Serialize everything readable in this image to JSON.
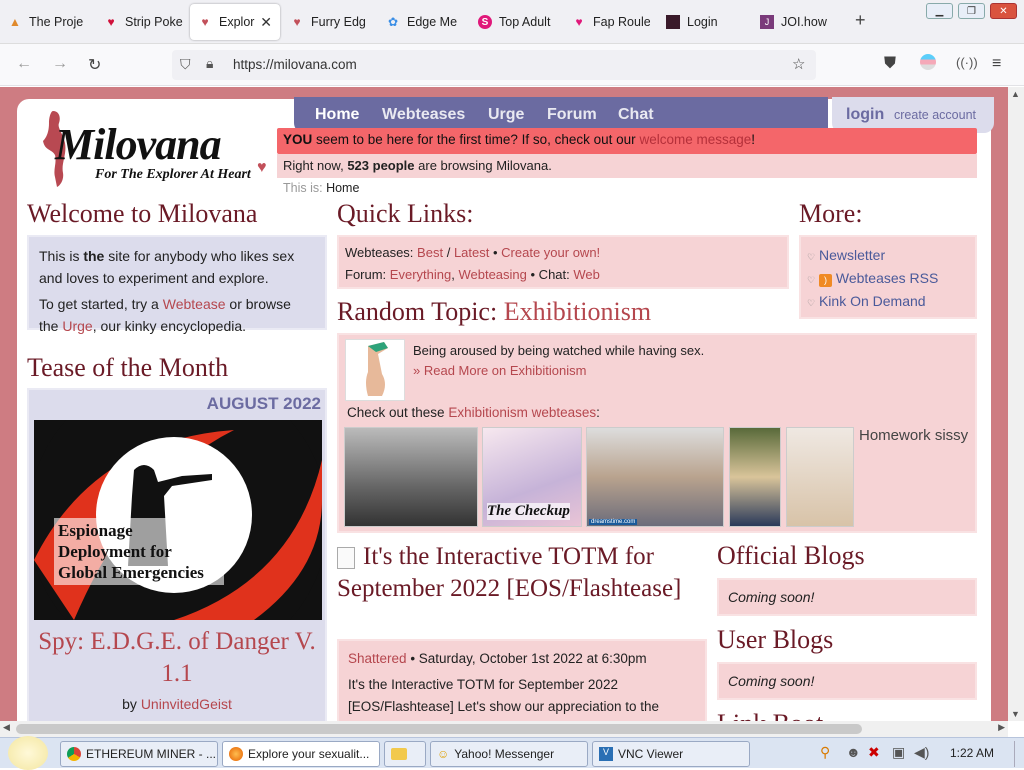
{
  "browser": {
    "tabs": [
      {
        "title": "The Proje",
        "icon": "project-icon"
      },
      {
        "title": "Strip Poke",
        "icon": "heart-icon"
      },
      {
        "title": "Explor",
        "icon": "milovana-heart-icon",
        "active": true
      },
      {
        "title": "Furry Edg",
        "icon": "milovana-heart-icon"
      },
      {
        "title": "Edge Me",
        "icon": "puzzle-icon"
      },
      {
        "title": "Top Adult",
        "icon": "s-circle-icon"
      },
      {
        "title": "Fap Roule",
        "icon": "heart-icon"
      },
      {
        "title": "Login",
        "icon": "dark-square-icon"
      },
      {
        "title": "JOI.how",
        "icon": "joi-icon"
      }
    ],
    "url": "https://milovana.com"
  },
  "site": {
    "logo_text": "Milovana",
    "logo_tagline": "For The Explorer At Heart",
    "menu": [
      "Home",
      "Webteases",
      "Urge",
      "Forum",
      "Chat"
    ],
    "login": "login",
    "create_account": "create account",
    "notice_you": "YOU",
    "notice_text": "seem to be here for the first time? If so, check out our",
    "notice_link": "welcome message",
    "notice_end": "!",
    "browsing_pre": "Right now,",
    "browsing_count": "523 people",
    "browsing_post": "are browsing Milovana.",
    "breadcrumb_label": "This is:",
    "breadcrumb_value": "Home"
  },
  "welcome": {
    "title": "Welcome to Milovana",
    "p1_a": "This is",
    "p1_b": "the",
    "p1_c": "site for anybody who likes sex",
    "p1_d": "and loves to experiment and explore.",
    "p2_a": "To get started, try a",
    "p2_link1": "Webtease",
    "p2_b": "or browse",
    "p2_c": "the",
    "p2_link2": "Urge",
    "p2_d": ", our kinky encyclopedia."
  },
  "totm": {
    "title": "Tease of the Month",
    "month": "AUGUST 2022",
    "cover_text": "Espionage Deployment for Global Emergencies",
    "tease_title": "Spy: E.D.G.E. of Danger V. 1.1",
    "by": "by",
    "author": "UninvitedGeist"
  },
  "quicklinks": {
    "title": "Quick Links:",
    "row1_label": "Webteases:",
    "row1_best": "Best",
    "row1_sep": "/",
    "row1_latest": "Latest",
    "row1_bullet": "•",
    "row1_create": "Create your own!",
    "row2_label": "Forum:",
    "row2_everything": "Everything",
    "row2_comma": ",",
    "row2_webteasing": "Webteasing",
    "row2_chat": "• Chat:",
    "row2_web": "Web"
  },
  "more": {
    "title": "More:",
    "items": [
      "Newsletter",
      "Webteases RSS",
      "Kink On Demand"
    ]
  },
  "random": {
    "title_prefix": "Random Topic:",
    "topic": "Exhibitionism",
    "desc": "Being aroused by being watched while having sex.",
    "read_more_arrow": "»",
    "read_more": "Read More on Exhibitionism",
    "checkout": "Check out these",
    "checkout_link": "Exhibitionism webteases",
    "checkout_colon": ":",
    "thumb2_text": "The Checkup",
    "thumb3_watermark": "dreamstime.com",
    "homework": "Homework sissy"
  },
  "news": {
    "title": "It's the Interactive TOTM for September 2022 [EOS/Flashtease]",
    "author": "Shattered",
    "date": "• Saturday, October 1st 2022 at 6:30pm",
    "body": "It's the Interactive TOTM for September 2022 [EOS/Flashtease] Let's show our appreciation to the"
  },
  "blogs": {
    "official_title": "Official Blogs",
    "official_text": "Coming soon!",
    "user_title": "User Blogs",
    "user_text": "Coming soon!",
    "next_title": "Link Boot"
  },
  "taskbar": {
    "items": [
      {
        "label": "ETHEREUM MINER - ...",
        "icon": "chrome-icon"
      },
      {
        "label": "Explore your sexualit...",
        "icon": "firefox-icon",
        "active": true
      },
      {
        "label": "",
        "icon": "folder-icon"
      },
      {
        "label": "Yahoo! Messenger",
        "icon": "yahoo-smiley-icon"
      },
      {
        "label": "VNC Viewer",
        "icon": "vnc-icon"
      }
    ],
    "clock": "1:22 AM"
  },
  "colors": {
    "accent": "#6b6ba1",
    "pink_bg": "#f6d3d5",
    "link": "#b5474e",
    "heading": "#6a1a26",
    "notice": "#f4666a"
  }
}
